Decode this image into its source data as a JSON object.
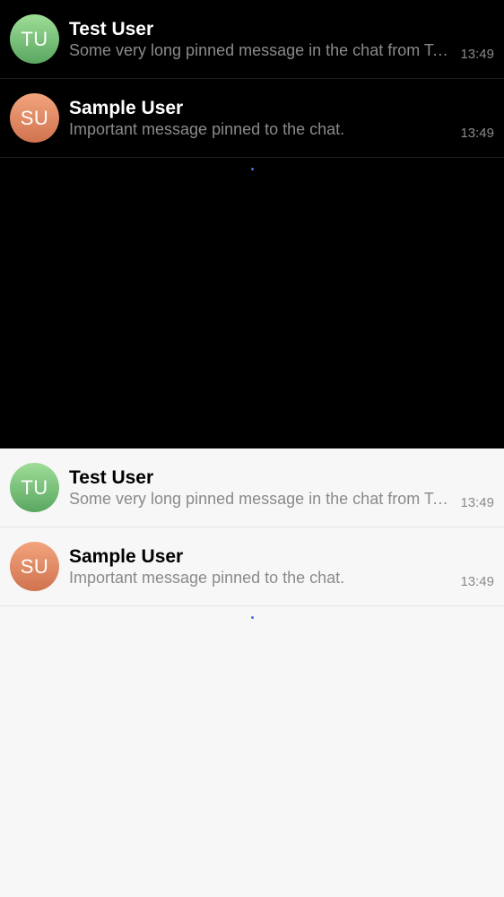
{
  "dark_panel": {
    "items": [
      {
        "initials": "TU",
        "name": "Test User",
        "message": "Some very long pinned message in the chat from Test User that does not fit",
        "time": "13:49"
      },
      {
        "initials": "SU",
        "name": "Sample User",
        "message": "Important message pinned to the chat.",
        "time": "13:49"
      }
    ]
  },
  "light_panel": {
    "items": [
      {
        "initials": "TU",
        "name": "Test User",
        "message": "Some very long pinned message in the chat from Test User that does not fit",
        "time": "13:49"
      },
      {
        "initials": "SU",
        "name": "Sample User",
        "message": "Important message pinned to the chat.",
        "time": "13:49"
      }
    ]
  },
  "colors": {
    "avatar_tu": "#7cc47a",
    "avatar_su": "#e38a62",
    "loading_dot": "#3b74e6"
  }
}
